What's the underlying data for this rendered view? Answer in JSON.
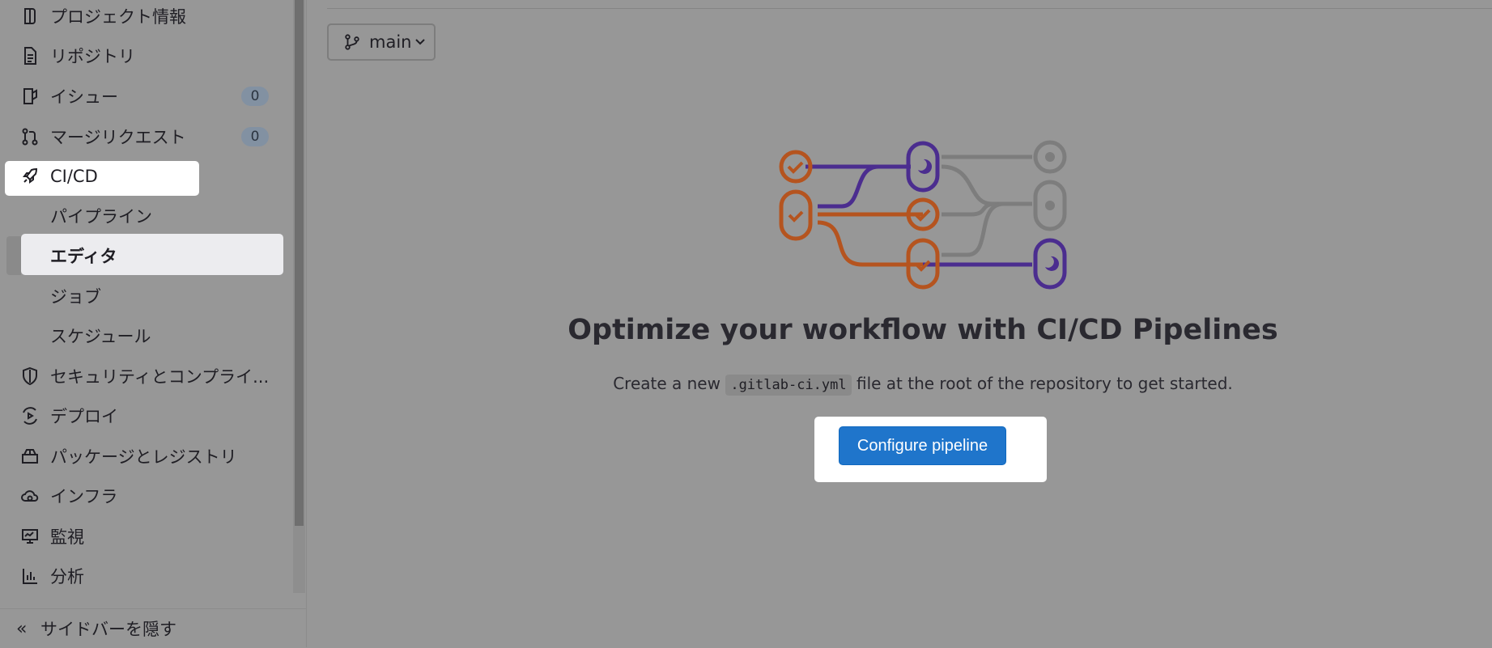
{
  "sidebar": {
    "items": [
      {
        "label": "プロジェクト情報",
        "icon": "project-icon"
      },
      {
        "label": "リポジトリ",
        "icon": "document-icon"
      },
      {
        "label": "イシュー",
        "icon": "issues-icon",
        "badge": "0"
      },
      {
        "label": "マージリクエスト",
        "icon": "merge-request-icon",
        "badge": "0"
      },
      {
        "label": "CI/CD",
        "icon": "rocket-icon"
      },
      {
        "label": "パイプライン"
      },
      {
        "label": "エディタ"
      },
      {
        "label": "ジョブ"
      },
      {
        "label": "スケジュール"
      },
      {
        "label": "セキュリティとコンプライ...",
        "icon": "shield-icon"
      },
      {
        "label": "デプロイ",
        "icon": "deployments-icon"
      },
      {
        "label": "パッケージとレジストリ",
        "icon": "package-icon"
      },
      {
        "label": "インフラ",
        "icon": "cloud-gear-icon"
      },
      {
        "label": "監視",
        "icon": "monitor-icon"
      },
      {
        "label": "分析",
        "icon": "chart-icon"
      }
    ],
    "collapse_label": "サイドバーを隠す"
  },
  "branch": {
    "label": "main"
  },
  "empty_state": {
    "title": "Optimize your workflow with CI/CD Pipelines",
    "desc_before": "Create a new ",
    "desc_code": ".gitlab-ci.yml",
    "desc_after": " file at the root of the repository to get started.",
    "button_label": "Configure pipeline"
  },
  "colors": {
    "overlay_background": "#979797",
    "primary_button": "#1f75cb",
    "illustration_orange": "#b5541f",
    "illustration_purple": "#4b2d8f",
    "illustration_gray": "#7d7d7d"
  }
}
